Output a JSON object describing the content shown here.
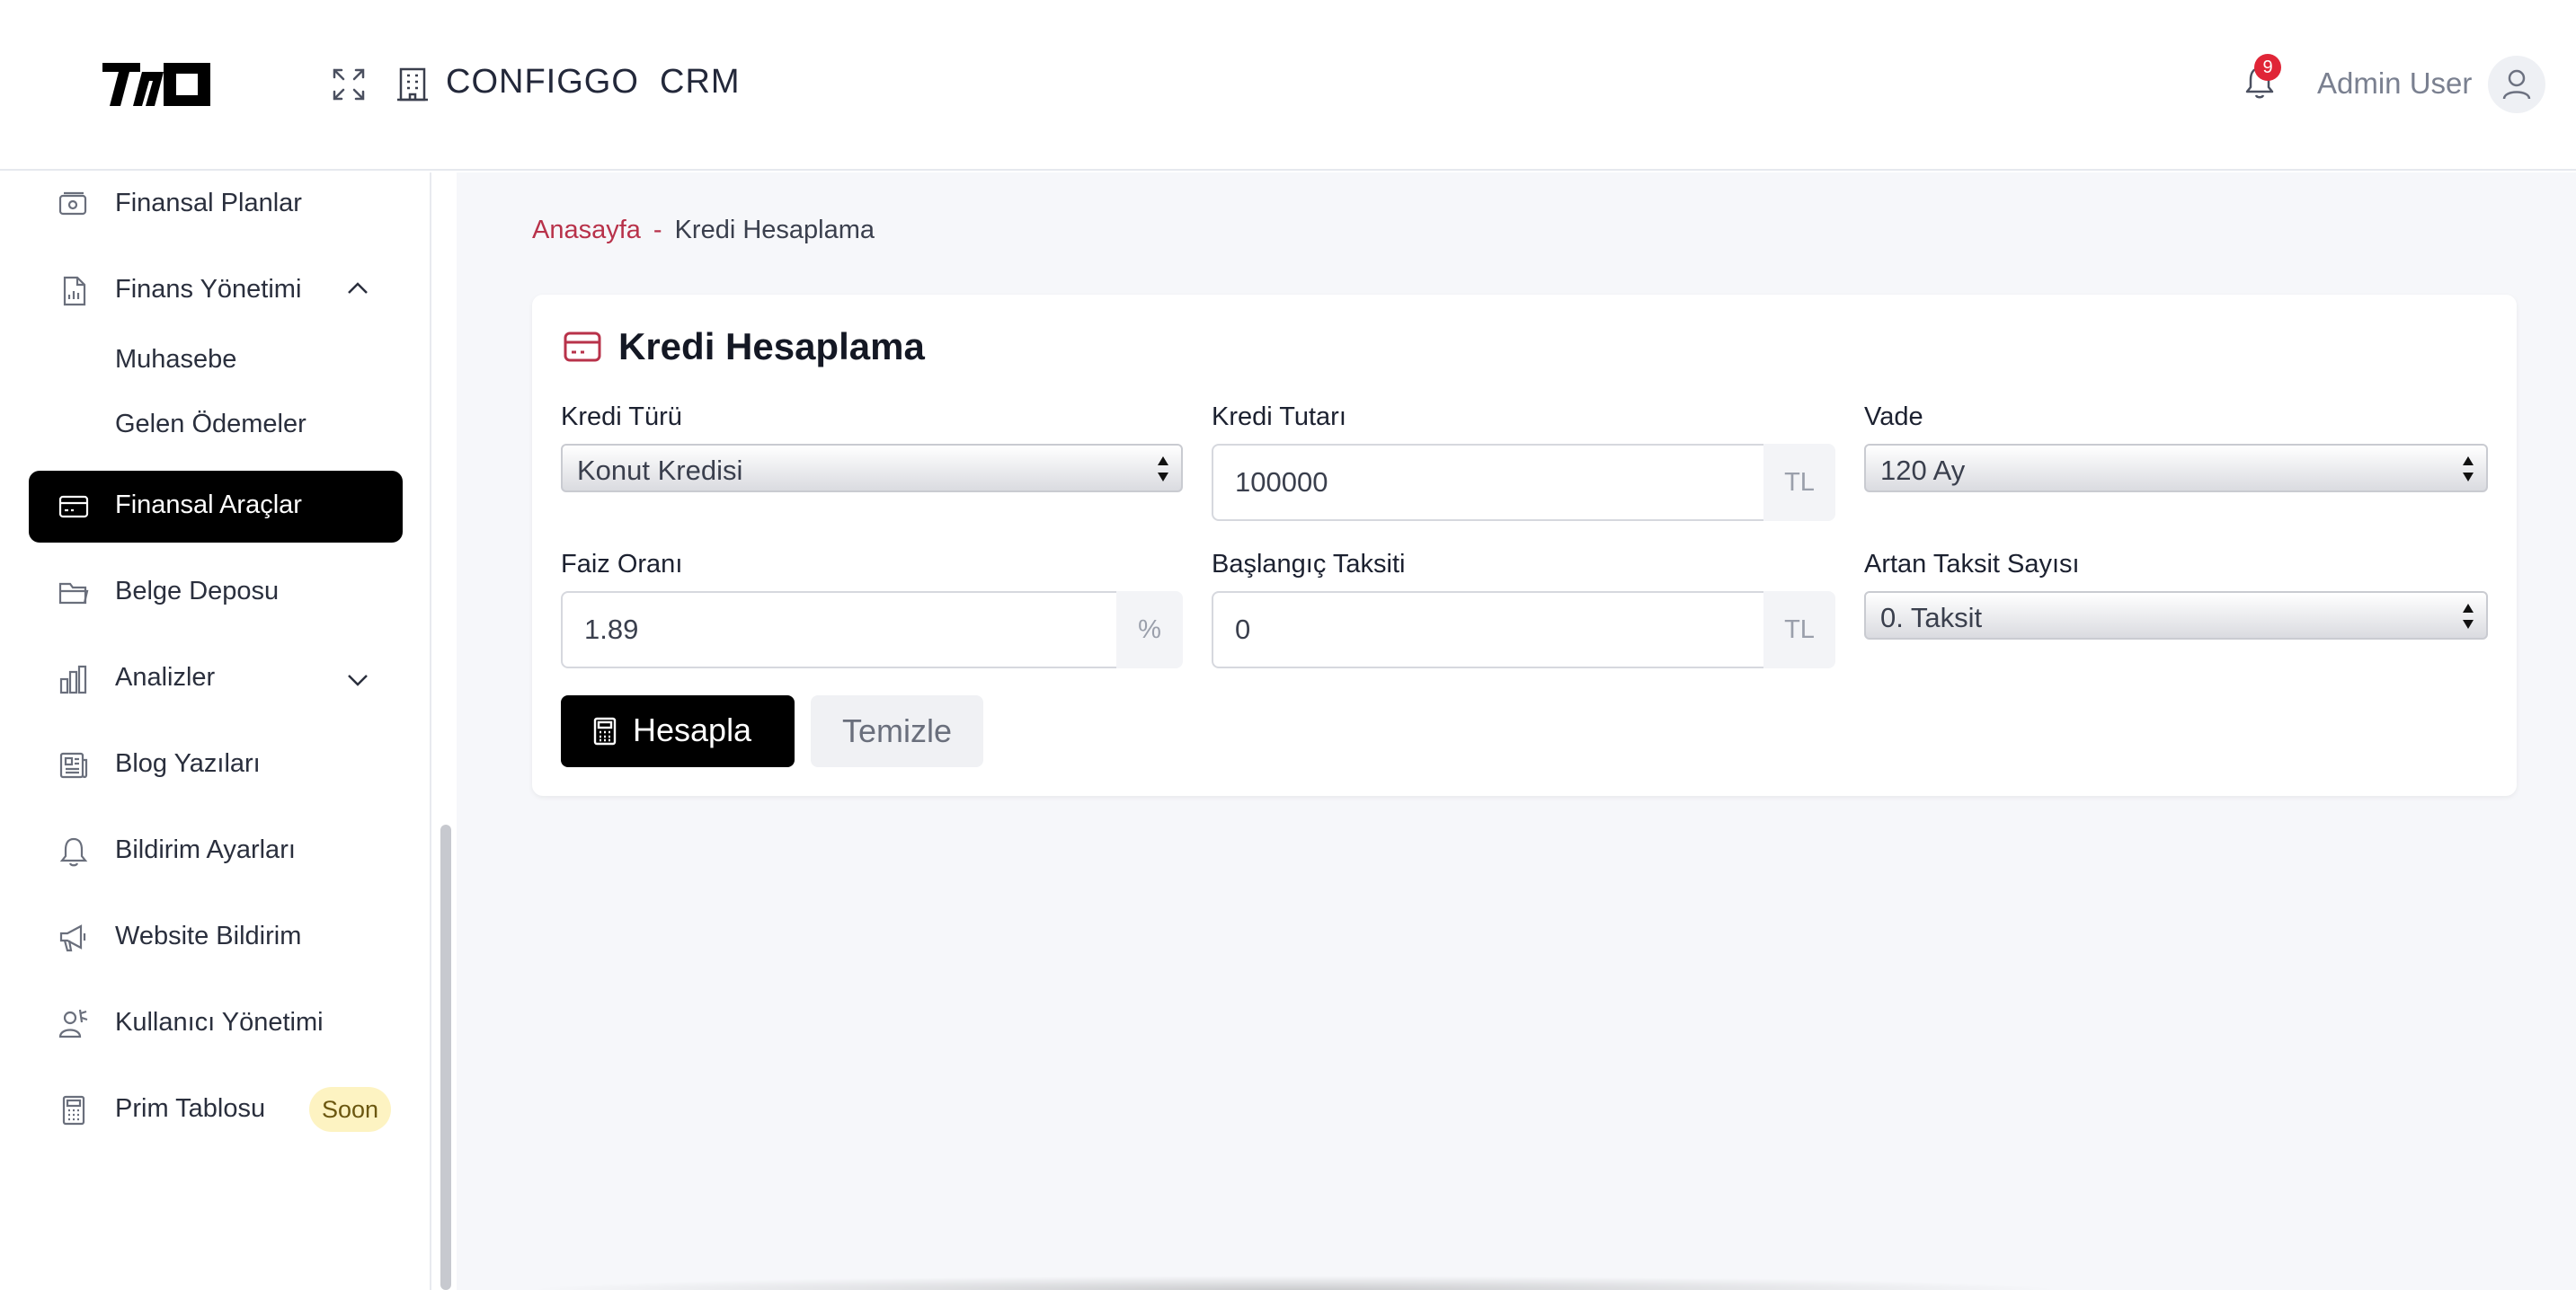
{
  "header": {
    "app_title": "CONFIGGO  CRM",
    "notification_count": "9",
    "user_name": "Admin User",
    "badge_color": "#e02537"
  },
  "sidebar": {
    "items": [
      {
        "label": "Finansal Planlar",
        "icon": "money-icon"
      },
      {
        "label": "Finans Yönetimi",
        "icon": "report-icon",
        "expanded": true,
        "children": [
          {
            "label": "Muhasebe"
          },
          {
            "label": "Gelen Ödemeler"
          }
        ]
      },
      {
        "label": "Finansal Araçlar",
        "icon": "credit-card-icon",
        "active": true
      },
      {
        "label": "Belge Deposu",
        "icon": "folder-icon"
      },
      {
        "label": "Analizler",
        "icon": "bar-chart-icon",
        "expanded": false
      },
      {
        "label": "Blog Yazıları",
        "icon": "newspaper-icon"
      },
      {
        "label": "Bildirim Ayarları",
        "icon": "bell-icon"
      },
      {
        "label": "Website Bildirim",
        "icon": "megaphone-icon"
      },
      {
        "label": "Kullanıcı Yönetimi",
        "icon": "user-settings-icon"
      },
      {
        "label": "Prim Tablosu",
        "icon": "calculator-icon",
        "badge": "Soon"
      }
    ]
  },
  "breadcrumb": {
    "home": "Anasayfa",
    "separator": "-",
    "current": "Kredi Hesaplama",
    "accent_color": "#b8324a"
  },
  "form": {
    "title": "Kredi Hesaplama",
    "loan_type": {
      "label": "Kredi Türü",
      "value": "Konut Kredisi"
    },
    "loan_amount": {
      "label": "Kredi Tutarı",
      "value": "100000",
      "suffix": "TL"
    },
    "term": {
      "label": "Vade",
      "value": "120 Ay"
    },
    "interest_rate": {
      "label": "Faiz Oranı",
      "value": "1.89",
      "suffix": "%"
    },
    "initial_installment": {
      "label": "Başlangıç Taksiti",
      "value": "0",
      "suffix": "TL"
    },
    "increasing_installments": {
      "label": "Artan Taksit Sayısı",
      "value": "0. Taksit"
    },
    "calculate_label": "Hesapla",
    "clear_label": "Temizle"
  }
}
